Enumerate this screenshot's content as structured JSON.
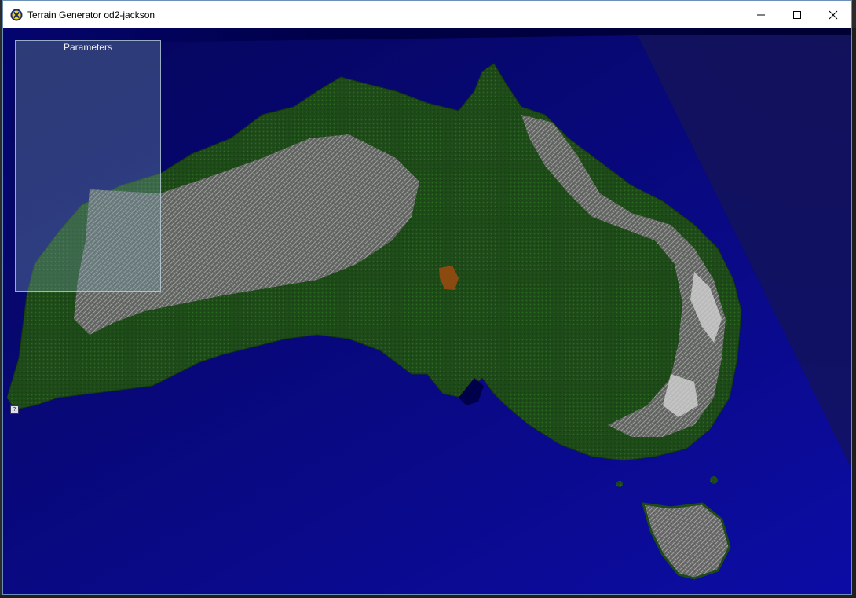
{
  "window": {
    "title": "Terrain Generator od2-jackson",
    "controls": [
      "minimize-icon",
      "maximize-icon",
      "close-icon"
    ]
  },
  "viewport": {
    "scene": "terrain-render",
    "colors": {
      "water_dark": "#00004a",
      "water_light": "#0a0a9a",
      "land_green": "#1f4f1a",
      "land_rock": "#7a7a7a",
      "desert_spot": "#8a4a10"
    }
  },
  "parameters_panel": {
    "title": "Parameters"
  },
  "help_button": {
    "label": "?"
  }
}
